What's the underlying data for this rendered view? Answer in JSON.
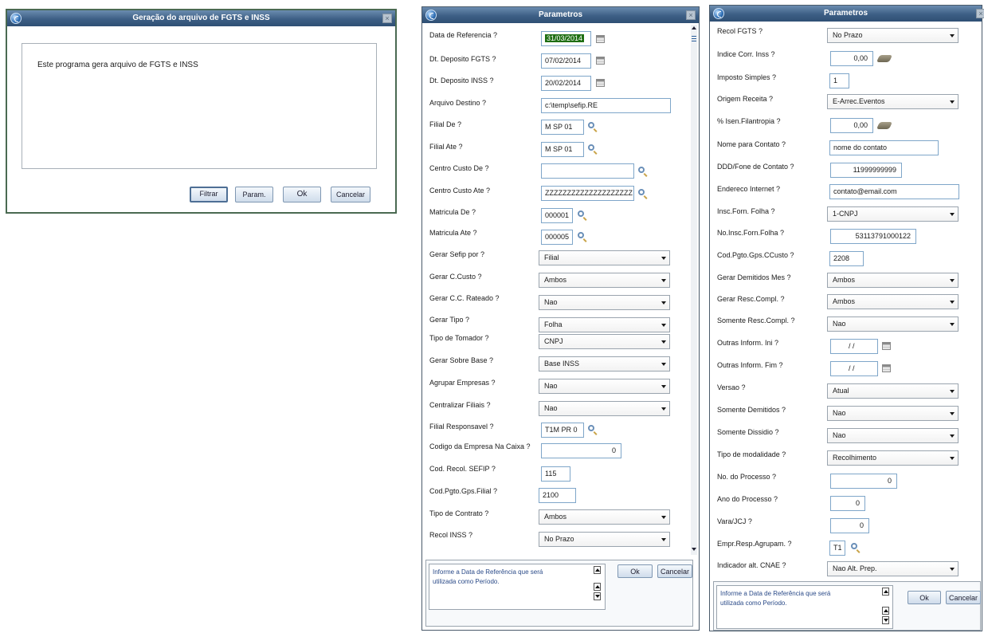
{
  "dialog1": {
    "title": "Geração do arquivo de FGTS e INSS",
    "close": "×",
    "message": "Este programa gera arquivo de FGTS e INSS",
    "buttons": {
      "filtrar": "Filtrar",
      "param": "Param.",
      "ok": "Ok",
      "cancelar": "Cancelar"
    }
  },
  "dialog2": {
    "title": "Parametros",
    "close": "×",
    "fields": {
      "data_ref": {
        "label": "Data de Referencia ?",
        "value": "31/03/2014"
      },
      "dt_dep_fgts": {
        "label": "Dt. Deposito FGTS ?",
        "value": "07/02/2014"
      },
      "dt_dep_inss": {
        "label": "Dt. Deposito INSS ?",
        "value": "20/02/2014"
      },
      "arquivo_destino": {
        "label": "Arquivo Destino ?",
        "value": "c:\\temp\\sefip.RE"
      },
      "filial_de": {
        "label": "Filial De ?",
        "value": "M SP 01"
      },
      "filial_ate": {
        "label": "Filial Ate ?",
        "value": "M SP 01"
      },
      "centro_custo_de": {
        "label": "Centro Custo De ?",
        "value": ""
      },
      "centro_custo_ate": {
        "label": "Centro Custo Ate ?",
        "value": "ZZZZZZZZZZZZZZZZZZZZ"
      },
      "matricula_de": {
        "label": "Matricula De ?",
        "value": "000001"
      },
      "matricula_ate": {
        "label": "Matricula Ate ?",
        "value": "000005"
      },
      "gerar_sefip_por": {
        "label": "Gerar Sefip por ?",
        "value": "Filial"
      },
      "gerar_ccusto": {
        "label": "Gerar C.Custo ?",
        "value": "Ambos"
      },
      "gerar_cc_rateado": {
        "label": "Gerar C.C. Rateado ?",
        "value": "Nao"
      },
      "gerar_tipo": {
        "label": "Gerar Tipo ?",
        "value": "Folha"
      },
      "tipo_tomador": {
        "label": "Tipo de Tomador ?",
        "value": "CNPJ"
      },
      "gerar_sobre_base": {
        "label": "Gerar Sobre Base ?",
        "value": "Base INSS"
      },
      "agrupar_empresas": {
        "label": "Agrupar Empresas ?",
        "value": "Nao"
      },
      "centralizar_filiais": {
        "label": "Centralizar Filiais ?",
        "value": "Nao"
      },
      "filial_responsavel": {
        "label": "Filial Responsavel ?",
        "value": "T1M PR 0"
      },
      "codigo_empresa_caixa": {
        "label": "Codigo da Empresa Na Caixa ?",
        "value": "0"
      },
      "cod_recol_sefip": {
        "label": "Cod. Recol. SEFIP ?",
        "value": "115"
      },
      "cod_pgto_gps_filial": {
        "label": "Cod.Pgto.Gps.Filial ?",
        "value": "2100"
      },
      "tipo_contrato": {
        "label": "Tipo de Contrato ?",
        "value": "Ambos"
      },
      "recol_inss": {
        "label": "Recol INSS ?",
        "value": "No Prazo"
      }
    },
    "help_line1": "Informe a Data de Referência que será",
    "help_line2": "utilizada como Período.",
    "buttons": {
      "ok": "Ok",
      "cancelar": "Cancelar"
    }
  },
  "dialog3": {
    "title": "Parametros",
    "close": "×",
    "fields": {
      "recol_fgts": {
        "label": "Recol FGTS ?",
        "value": "No Prazo"
      },
      "indice_corr_inss": {
        "label": "Indice Corr. Inss ?",
        "value": "0,00"
      },
      "imposto_simples": {
        "label": "Imposto Simples ?",
        "value": "1"
      },
      "origem_receita": {
        "label": "Origem Receita ?",
        "value": "E-Arrec.Eventos"
      },
      "isen_filantropia": {
        "label": "% Isen.Filantropia ?",
        "value": "0,00"
      },
      "nome_contato": {
        "label": "Nome para Contato ?",
        "value": "nome do contato"
      },
      "ddd_fone": {
        "label": "DDD/Fone de Contato ?",
        "value": "11999999999"
      },
      "endereco_internet": {
        "label": "Endereco Internet ?",
        "value": "contato@email.com"
      },
      "insc_forn_folha": {
        "label": "Insc.Forn. Folha ?",
        "value": "1-CNPJ"
      },
      "no_insc_forn_folha": {
        "label": "No.Insc.Forn.Folha ?",
        "value": "53113791000122"
      },
      "cod_pgto_gps_ccusto": {
        "label": "Cod.Pgto.Gps.CCusto ?",
        "value": "2208"
      },
      "gerar_demitidos_mes": {
        "label": "Gerar Demitidos Mes ?",
        "value": "Ambos"
      },
      "gerar_resc_compl": {
        "label": "Gerar Resc.Compl. ?",
        "value": "Ambos"
      },
      "somente_resc_compl": {
        "label": "Somente Resc.Compl. ?",
        "value": "Nao"
      },
      "outras_inform_ini": {
        "label": "Outras Inform. Ini ?",
        "value": "/ /"
      },
      "outras_inform_fim": {
        "label": "Outras Inform. Fim ?",
        "value": "/ /"
      },
      "versao": {
        "label": "Versao ?",
        "value": "Atual"
      },
      "somente_demitidos": {
        "label": "Somente Demitidos ?",
        "value": "Nao"
      },
      "somente_dissidio": {
        "label": "Somente Dissidio ?",
        "value": "Nao"
      },
      "tipo_modalidade": {
        "label": "Tipo de modalidade ?",
        "value": "Recolhimento"
      },
      "no_processo": {
        "label": "No. do Processo ?",
        "value": "0"
      },
      "ano_processo": {
        "label": "Ano do Processo ?",
        "value": "0"
      },
      "vara_jcj": {
        "label": "Vara/JCJ ?",
        "value": "0"
      },
      "empr_resp_agrupam": {
        "label": "Empr.Resp.Agrupam. ?",
        "value": "T1"
      },
      "indicador_alt_cnae": {
        "label": "Indicador alt. CNAE ?",
        "value": "Nao Alt. Prep."
      }
    },
    "help_line1": "Informe a Data de Referência que será",
    "help_line2": "utilizada como Período.",
    "buttons": {
      "ok": "Ok",
      "cancelar": "Cancelar"
    }
  }
}
